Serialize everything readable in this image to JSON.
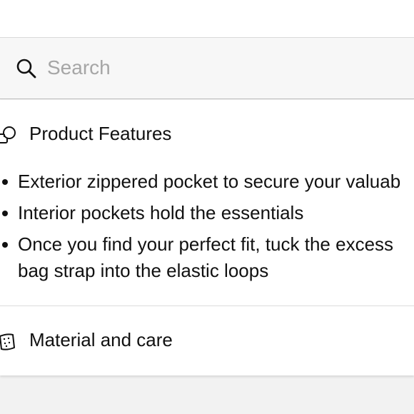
{
  "search": {
    "placeholder": "Search",
    "value": ""
  },
  "sections": {
    "features": {
      "title": "Product Features",
      "icon": "overlapping-shapes-icon",
      "items": [
        "Exterior zippered pocket to secure your valuab",
        "Interior pockets hold the essentials",
        "Once you find your perfect fit, tuck the excess bag strap into the elastic loops"
      ]
    },
    "material": {
      "title": "Material and care",
      "icon": "fabric-swatch-icon"
    }
  },
  "colors": {
    "background": "#f2f2f2",
    "panel": "#ffffff",
    "text": "#111111",
    "placeholder": "#a6a6a6"
  }
}
